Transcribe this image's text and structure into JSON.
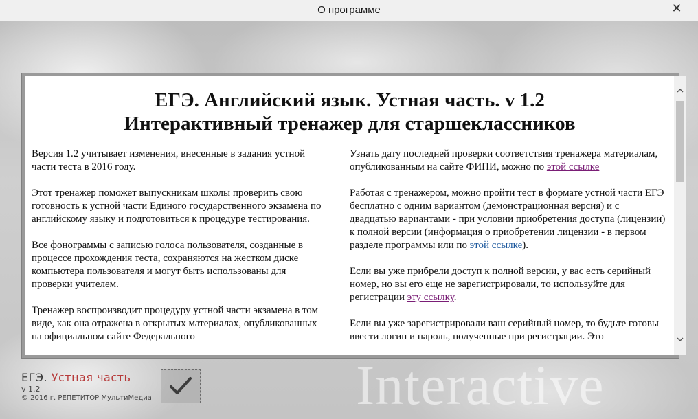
{
  "window": {
    "title": "О программе",
    "close_label": "✕"
  },
  "content": {
    "heading_line1": "ЕГЭ. Английский язык. Устная часть. v 1.2",
    "heading_line2": "Интерактивный тренажер для старшеклассников",
    "left": {
      "p1": "Версия 1.2 учитывает изменения, внесенные в задания устной части теста в 2016 году.",
      "p2": "Этот тренажер поможет выпускникам школы проверить свою готовность к устной части Единого государственного экзамена по английскому языку и подготовиться к процедуре тестирования.",
      "p3": "Все фонограммы с записью голоса пользователя, созданные в процессе прохождения теста, сохраняются на жестком диске компьютера пользователя и могут быть использованы для проверки учителем.",
      "p4": "Тренажер воспроизводит процедуру устной части экзамена в том виде, как она отражена в открытых материалах, опубликованных на официальном сайте Федерального"
    },
    "right": {
      "p1_text": "Узнать дату последней проверки соответствия тренажера материалам, опубликованным на сайте ФИПИ, можно по ",
      "p1_link": "этой ссылке",
      "p2_text": "Работая с тренажером, можно пройти тест в формате устной части ЕГЭ бесплатно с одним вариантом (демонстрационная версия) и с двадцатью вариантами - при условии приобретения доступа (лицензии) к полной версии (информация о приобретении лицензии - в первом разделе программы или по ",
      "p2_link": "этой ссылке",
      "p2_tail": ").",
      "p3_text": "Если вы уже прибрели доступ к полной версии, у вас есть серийный номер, но вы его еще не зарегистрировали, то используйте для регистрации ",
      "p3_link": "эту ссылку",
      "p3_tail": ".",
      "p4": "Если вы уже зарегистрировали ваш серийный номер, то будьте готовы ввести логин и пароль, полученные при регистрации. Это"
    }
  },
  "scrollbar": {
    "up_icon": "chevron-up-icon",
    "down_icon": "chevron-down-icon"
  },
  "footer": {
    "brand_prefix": "ЕГЭ.",
    "brand_suffix": "Устная часть",
    "version": "v 1.2",
    "copyright": "© 2016 г. РЕПЕТИТОР МультиМедиа",
    "ok_icon": "checkmark-icon",
    "watermark": "Interactive"
  },
  "colors": {
    "brand_accent": "#b63a3a",
    "link_visited": "#7a1e76",
    "link": "#1f5a9e"
  }
}
